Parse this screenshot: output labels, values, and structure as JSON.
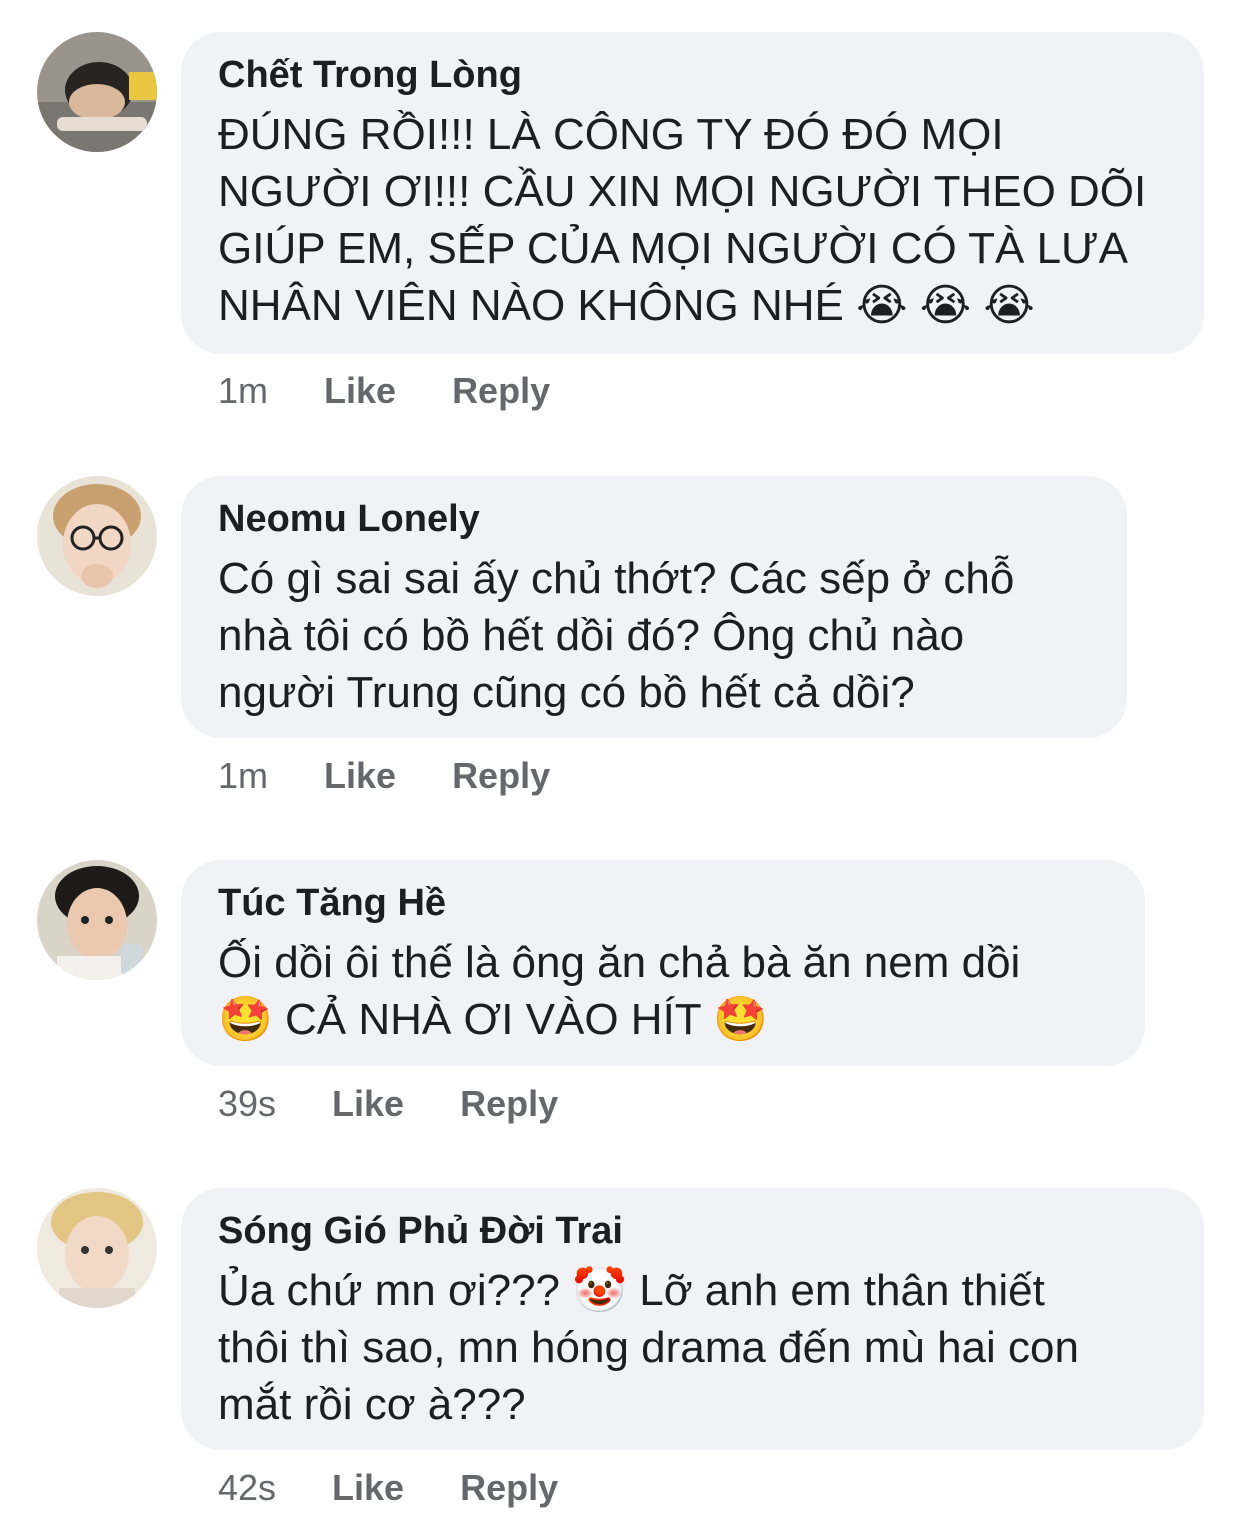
{
  "comments": [
    {
      "author": "Chết Trong Lòng",
      "lines": [
        "ĐÚNG RỒI!!! LÀ CÔNG TY ĐÓ ĐÓ MỌI",
        "NGƯỜI ƠI!!! CẦU XIN MỌI NGƯỜI THEO DÕI",
        "GIÚP EM, SẾP CỦA MỌI NGƯỜI CÓ TÀ LƯA",
        "NHÂN VIÊN NÀO KHÔNG NHÉ 😭 😭 😭"
      ],
      "time": "1m",
      "like": "Like",
      "reply": "Reply"
    },
    {
      "author": "Neomu Lonely",
      "lines": [
        "Có gì sai sai ấy chủ thớt? Các sếp ở chỗ",
        "nhà tôi có bồ hết dồi đó? Ông chủ nào",
        "người Trung cũng có bồ hết cả dồi?"
      ],
      "time": "1m",
      "like": "Like",
      "reply": "Reply"
    },
    {
      "author": "Túc Tăng Hề",
      "lines": [
        "Ối dồi ôi thế là ông ăn chả bà ăn nem dồi",
        "🤩 CẢ NHÀ ƠI VÀO HÍT 🤩"
      ],
      "time": "39s",
      "like": "Like",
      "reply": "Reply"
    },
    {
      "author": "Sóng Gió Phủ Đời Trai",
      "lines": [
        "Ủa chứ mn ơi??? 🤡 Lỡ anh em thân thiết",
        "thôi thì sao, mn hóng drama đến mù hai con",
        "mắt rồi cơ à???"
      ],
      "time": "42s",
      "like": "Like",
      "reply": "Reply"
    }
  ]
}
